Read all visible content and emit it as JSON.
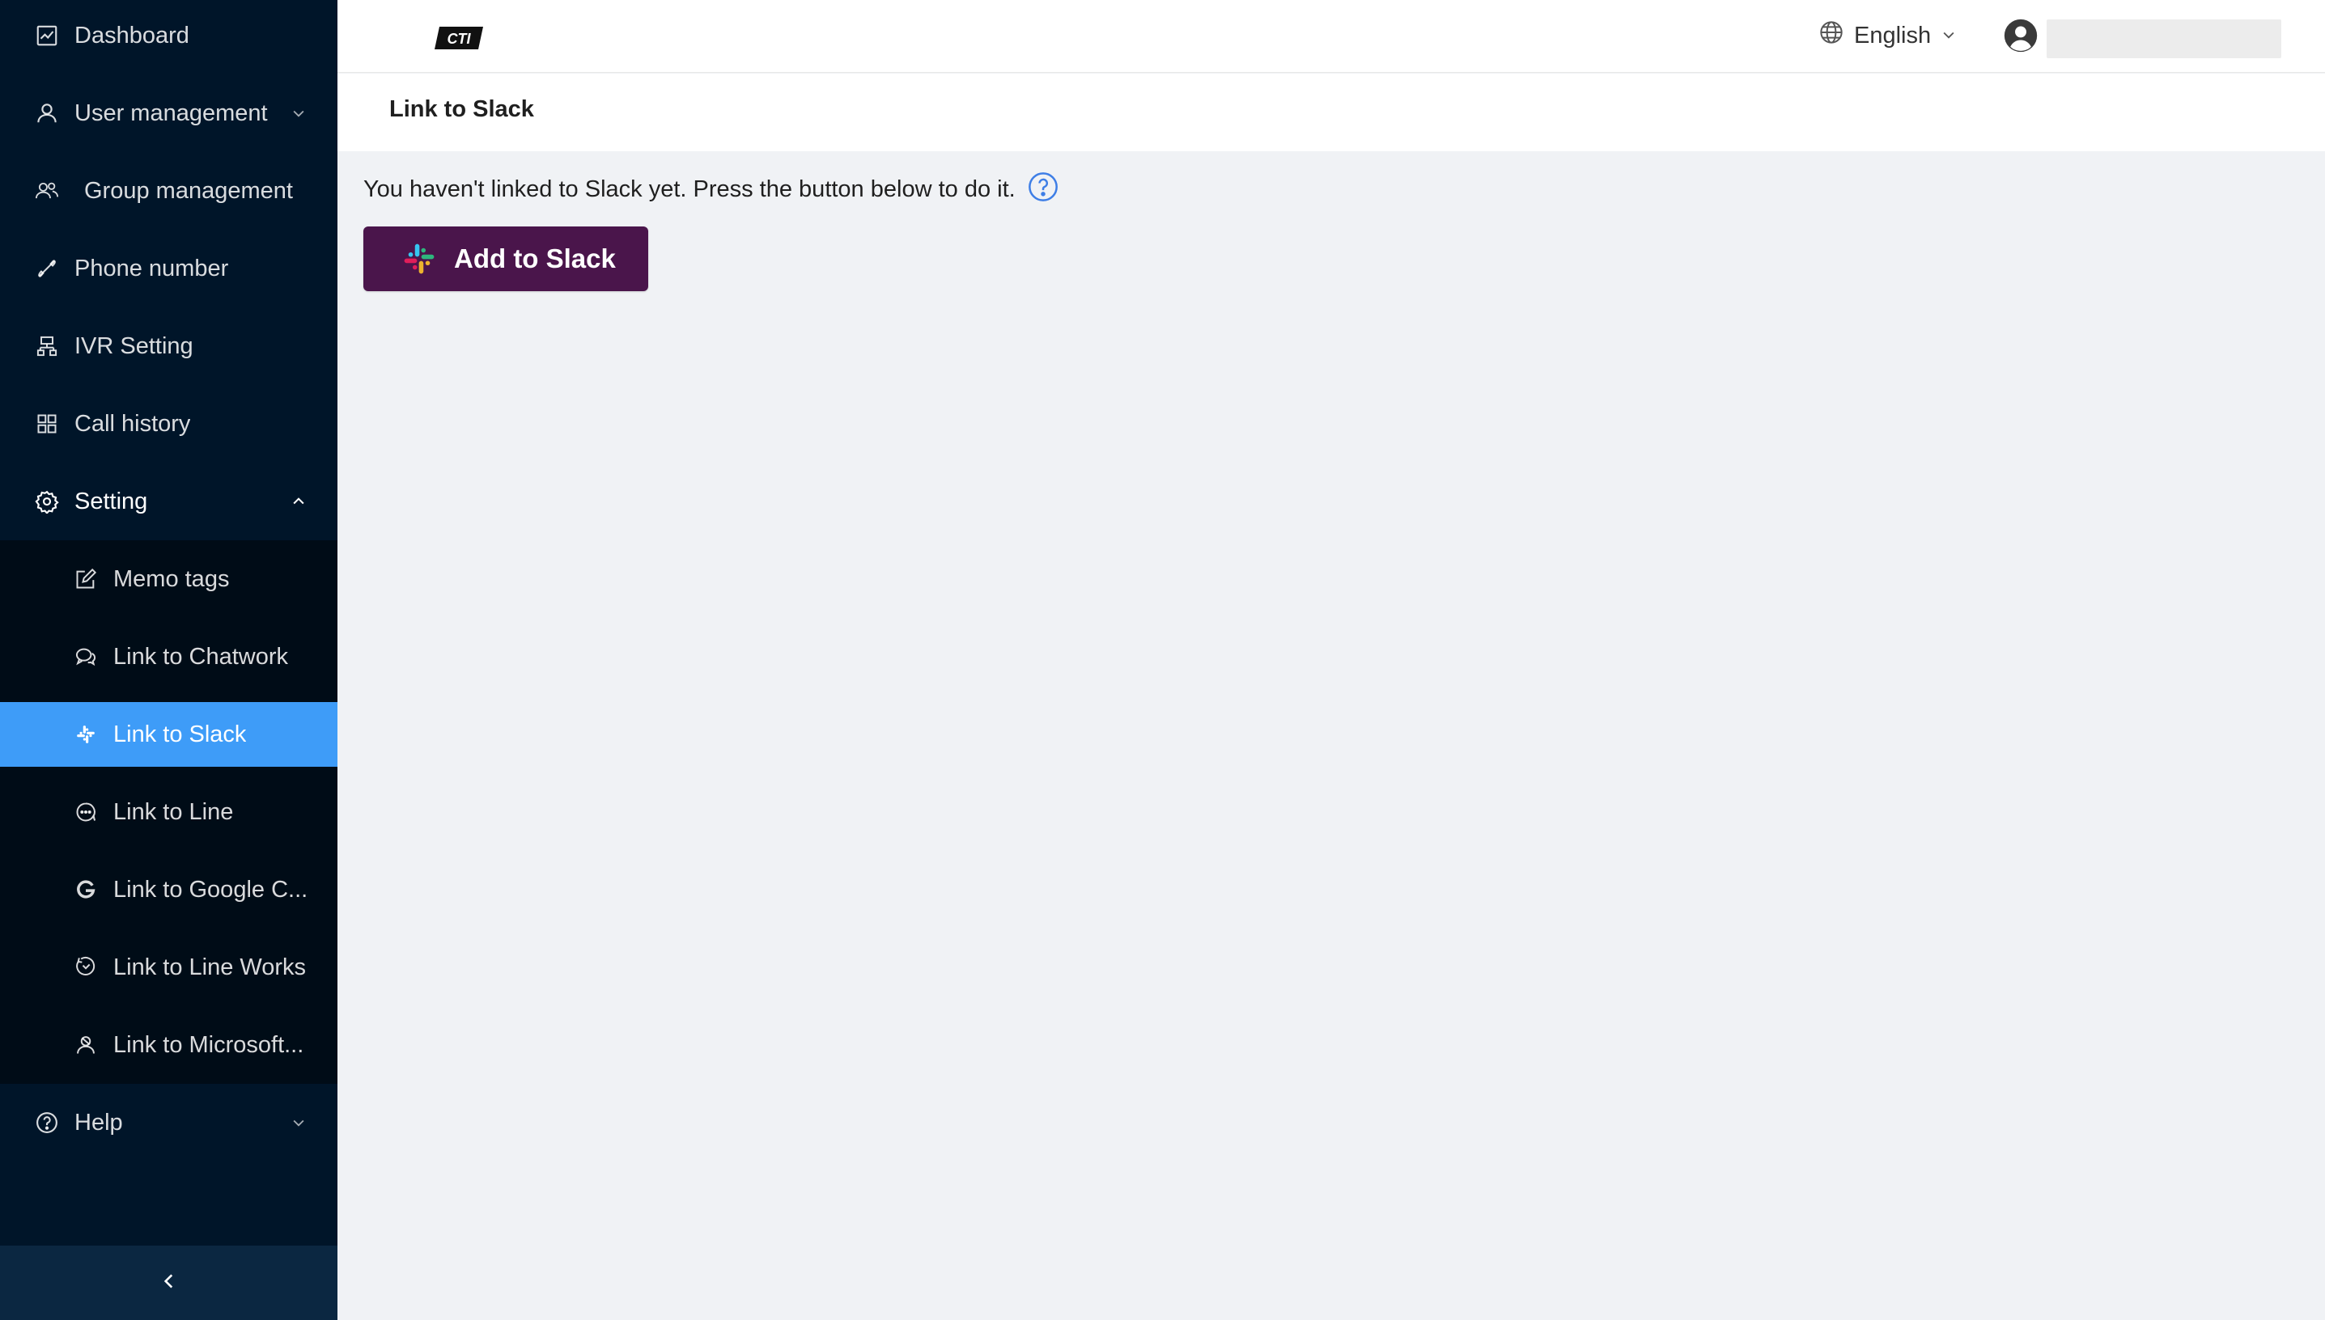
{
  "sidebar": {
    "items": [
      {
        "label": "Dashboard",
        "icon": "chart-icon"
      },
      {
        "label": "User management",
        "icon": "user-icon"
      },
      {
        "label": "Group management",
        "icon": "team-icon"
      },
      {
        "label": "Phone number",
        "icon": "phone-icon"
      },
      {
        "label": "IVR Setting",
        "icon": "cluster-icon"
      },
      {
        "label": "Call history",
        "icon": "appstore-icon"
      },
      {
        "label": "Setting",
        "icon": "gear-icon"
      },
      {
        "label": "Help",
        "icon": "question-icon"
      }
    ],
    "setting_children": [
      {
        "label": "Memo tags",
        "icon": "edit-icon"
      },
      {
        "label": "Link to Chatwork",
        "icon": "chat-icon"
      },
      {
        "label": "Link to Slack",
        "icon": "slack-icon"
      },
      {
        "label": "Link to Line",
        "icon": "message-icon"
      },
      {
        "label": "Link to Google C...",
        "icon": "google-icon"
      },
      {
        "label": "Link to Line Works",
        "icon": "line-works-icon"
      },
      {
        "label": "Link to Microsoft...",
        "icon": "microsoft-user-icon"
      }
    ]
  },
  "header": {
    "logo_text": "CTI",
    "language": "English"
  },
  "page": {
    "title": "Link to Slack",
    "info": "You haven't linked to Slack yet. Press the button below to do it.",
    "button_label": "Add to Slack"
  },
  "colors": {
    "sidebar_bg": "#001529",
    "submenu_bg": "#000c17",
    "selected_bg": "#3e9cf8",
    "slack_button": "#4a154b",
    "help_icon": "#3e7ee6"
  }
}
